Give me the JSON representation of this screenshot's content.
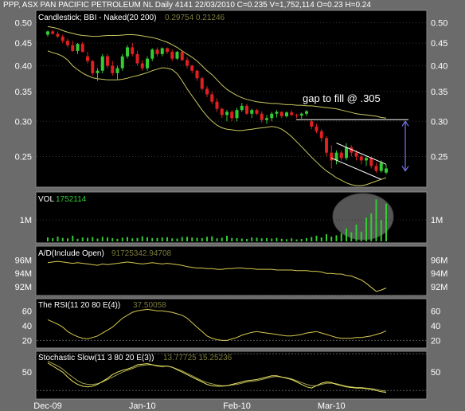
{
  "header": {
    "text": "PPP, ASX PAN PACIFIC PETROLEUM NL Daily 4141 22/03/2010 C=0.235 V=1,752,114 O=0.23 H=0.24"
  },
  "colors": {
    "background": "#6b6b6b",
    "panel": "#000000",
    "up": "#33cc33",
    "down": "#e02020",
    "band": "#c8c860",
    "line": "#d8c850",
    "volume": "#33cc33",
    "annotation": "#ffffff",
    "arrow": "#7777ee",
    "ellipse": "#555555"
  },
  "panels": {
    "price": {
      "label": "Candlestick; BBI - Naked(20  200)",
      "readout": "0.29754  0.21246",
      "yticks": [
        {
          "label": "0.50",
          "value": 0.5
        },
        {
          "label": "0.45",
          "value": 0.45
        },
        {
          "label": "0.40",
          "value": 0.4
        },
        {
          "label": "0.35",
          "value": 0.35
        },
        {
          "label": "0.30",
          "value": 0.3
        },
        {
          "label": "0.25",
          "value": 0.25
        }
      ],
      "annotation": "gap to fill @ .305"
    },
    "volume": {
      "label": "VOL",
      "readout": "1752114",
      "yticks": [
        {
          "label": "1M",
          "value": 1000000
        }
      ]
    },
    "ad": {
      "label": "A/D(Include Open)",
      "readout": "91725342.94708",
      "yticks": [
        {
          "label": "96M",
          "value": 96
        },
        {
          "label": "94M",
          "value": 94
        },
        {
          "label": "92M",
          "value": 92
        }
      ]
    },
    "rsi": {
      "label": "The RSI(11  20  80 E(4))",
      "readout": "37.50058",
      "yticks": [
        {
          "label": "60",
          "value": 60
        },
        {
          "label": "40",
          "value": 40
        },
        {
          "label": "20",
          "value": 20
        }
      ]
    },
    "stoch": {
      "label": "Stochastic Slow(11  3  80  20 E(3))",
      "readout": "13.77725  15.25236",
      "yticks": [
        {
          "label": "50",
          "value": 50
        }
      ]
    }
  },
  "xaxis": {
    "labels": [
      {
        "label": "Dec-09",
        "index": 0
      },
      {
        "label": "Jan-10",
        "index": 19
      },
      {
        "label": "Feb-10",
        "index": 38
      },
      {
        "label": "Mar-10",
        "index": 57
      }
    ]
  },
  "chart_data": {
    "type": "candlestick",
    "instrument": "PPP, ASX PAN PACIFIC PETROLEUM NL",
    "period": "Daily",
    "candles": [
      {
        "o": 0.47,
        "h": 0.48,
        "l": 0.465,
        "c": 0.478
      },
      {
        "o": 0.478,
        "h": 0.482,
        "l": 0.47,
        "c": 0.472
      },
      {
        "o": 0.472,
        "h": 0.478,
        "l": 0.462,
        "c": 0.465
      },
      {
        "o": 0.465,
        "h": 0.47,
        "l": 0.45,
        "c": 0.455
      },
      {
        "o": 0.455,
        "h": 0.46,
        "l": 0.44,
        "c": 0.445
      },
      {
        "o": 0.445,
        "h": 0.455,
        "l": 0.43,
        "c": 0.432
      },
      {
        "o": 0.432,
        "h": 0.45,
        "l": 0.425,
        "c": 0.448
      },
      {
        "o": 0.448,
        "h": 0.452,
        "l": 0.428,
        "c": 0.43
      },
      {
        "o": 0.42,
        "h": 0.43,
        "l": 0.405,
        "c": 0.41
      },
      {
        "o": 0.41,
        "h": 0.412,
        "l": 0.38,
        "c": 0.385
      },
      {
        "o": 0.385,
        "h": 0.395,
        "l": 0.37,
        "c": 0.39
      },
      {
        "o": 0.39,
        "h": 0.425,
        "l": 0.385,
        "c": 0.42
      },
      {
        "o": 0.42,
        "h": 0.425,
        "l": 0.395,
        "c": 0.4
      },
      {
        "o": 0.4,
        "h": 0.41,
        "l": 0.38,
        "c": 0.385
      },
      {
        "o": 0.385,
        "h": 0.4,
        "l": 0.372,
        "c": 0.395
      },
      {
        "o": 0.395,
        "h": 0.425,
        "l": 0.39,
        "c": 0.42
      },
      {
        "o": 0.42,
        "h": 0.445,
        "l": 0.415,
        "c": 0.44
      },
      {
        "o": 0.44,
        "h": 0.45,
        "l": 0.42,
        "c": 0.425
      },
      {
        "o": 0.425,
        "h": 0.432,
        "l": 0.4,
        "c": 0.405
      },
      {
        "o": 0.405,
        "h": 0.412,
        "l": 0.39,
        "c": 0.395
      },
      {
        "o": 0.395,
        "h": 0.42,
        "l": 0.39,
        "c": 0.415
      },
      {
        "o": 0.415,
        "h": 0.438,
        "l": 0.41,
        "c": 0.435
      },
      {
        "o": 0.435,
        "h": 0.44,
        "l": 0.42,
        "c": 0.425
      },
      {
        "o": 0.425,
        "h": 0.44,
        "l": 0.42,
        "c": 0.438
      },
      {
        "o": 0.438,
        "h": 0.44,
        "l": 0.425,
        "c": 0.43
      },
      {
        "o": 0.43,
        "h": 0.435,
        "l": 0.41,
        "c": 0.415
      },
      {
        "o": 0.415,
        "h": 0.432,
        "l": 0.412,
        "c": 0.43
      },
      {
        "o": 0.43,
        "h": 0.432,
        "l": 0.41,
        "c": 0.412
      },
      {
        "o": 0.412,
        "h": 0.418,
        "l": 0.395,
        "c": 0.4
      },
      {
        "o": 0.4,
        "h": 0.402,
        "l": 0.385,
        "c": 0.39
      },
      {
        "o": 0.39,
        "h": 0.392,
        "l": 0.37,
        "c": 0.375
      },
      {
        "o": 0.375,
        "h": 0.378,
        "l": 0.352,
        "c": 0.355
      },
      {
        "o": 0.355,
        "h": 0.36,
        "l": 0.34,
        "c": 0.345
      },
      {
        "o": 0.345,
        "h": 0.35,
        "l": 0.328,
        "c": 0.332
      },
      {
        "o": 0.332,
        "h": 0.338,
        "l": 0.315,
        "c": 0.32
      },
      {
        "o": 0.32,
        "h": 0.322,
        "l": 0.305,
        "c": 0.31
      },
      {
        "o": 0.31,
        "h": 0.318,
        "l": 0.3,
        "c": 0.315
      },
      {
        "o": 0.315,
        "h": 0.318,
        "l": 0.3,
        "c": 0.305
      },
      {
        "o": 0.305,
        "h": 0.322,
        "l": 0.3,
        "c": 0.318
      },
      {
        "o": 0.318,
        "h": 0.33,
        "l": 0.315,
        "c": 0.325
      },
      {
        "o": 0.325,
        "h": 0.328,
        "l": 0.31,
        "c": 0.312
      },
      {
        "o": 0.312,
        "h": 0.32,
        "l": 0.305,
        "c": 0.318
      },
      {
        "o": 0.318,
        "h": 0.32,
        "l": 0.31,
        "c": 0.312
      },
      {
        "o": 0.312,
        "h": 0.316,
        "l": 0.298,
        "c": 0.302
      },
      {
        "o": 0.302,
        "h": 0.31,
        "l": 0.296,
        "c": 0.305
      },
      {
        "o": 0.305,
        "h": 0.315,
        "l": 0.3,
        "c": 0.312
      },
      {
        "o": 0.312,
        "h": 0.318,
        "l": 0.306,
        "c": 0.315
      },
      {
        "o": 0.315,
        "h": 0.316,
        "l": 0.305,
        "c": 0.308
      },
      {
        "o": 0.308,
        "h": 0.316,
        "l": 0.306,
        "c": 0.314
      },
      {
        "o": 0.314,
        "h": 0.318,
        "l": 0.308,
        "c": 0.31
      },
      {
        "o": 0.31,
        "h": 0.312,
        "l": 0.305,
        "c": 0.309
      },
      {
        "o": 0.309,
        "h": 0.314,
        "l": 0.304,
        "c": 0.312
      },
      {
        "o": 0.312,
        "h": 0.318,
        "l": 0.308,
        "c": 0.316
      },
      {
        "o": 0.3,
        "h": 0.302,
        "l": 0.288,
        "c": 0.292
      },
      {
        "o": 0.292,
        "h": 0.296,
        "l": 0.282,
        "c": 0.285
      },
      {
        "o": 0.285,
        "h": 0.288,
        "l": 0.27,
        "c": 0.275
      },
      {
        "o": 0.275,
        "h": 0.278,
        "l": 0.25,
        "c": 0.255
      },
      {
        "o": 0.255,
        "h": 0.265,
        "l": 0.235,
        "c": 0.245
      },
      {
        "o": 0.245,
        "h": 0.258,
        "l": 0.24,
        "c": 0.255
      },
      {
        "o": 0.255,
        "h": 0.258,
        "l": 0.245,
        "c": 0.248
      },
      {
        "o": 0.248,
        "h": 0.268,
        "l": 0.245,
        "c": 0.262
      },
      {
        "o": 0.262,
        "h": 0.265,
        "l": 0.25,
        "c": 0.255
      },
      {
        "o": 0.255,
        "h": 0.258,
        "l": 0.245,
        "c": 0.25
      },
      {
        "o": 0.25,
        "h": 0.252,
        "l": 0.24,
        "c": 0.245
      },
      {
        "o": 0.245,
        "h": 0.25,
        "l": 0.238,
        "c": 0.248
      },
      {
        "o": 0.248,
        "h": 0.25,
        "l": 0.235,
        "c": 0.238
      },
      {
        "o": 0.238,
        "h": 0.242,
        "l": 0.23,
        "c": 0.232
      },
      {
        "o": 0.232,
        "h": 0.245,
        "l": 0.23,
        "c": 0.242
      },
      {
        "o": 0.23,
        "h": 0.24,
        "l": 0.228,
        "c": 0.235
      }
    ],
    "volume": [
      180000,
      150000,
      220000,
      160000,
      140000,
      260000,
      120000,
      180000,
      160000,
      200000,
      130000,
      210000,
      180000,
      150000,
      120000,
      170000,
      200000,
      140000,
      160000,
      230000,
      190000,
      150000,
      160000,
      180000,
      190000,
      140000,
      130000,
      200000,
      210000,
      180000,
      160000,
      150000,
      210000,
      230000,
      140000,
      170000,
      260000,
      160000,
      150000,
      130000,
      110000,
      180000,
      170000,
      140000,
      150000,
      130000,
      160000,
      120000,
      100000,
      140000,
      90000,
      110000,
      150000,
      200000,
      260000,
      180000,
      330000,
      220000,
      280000,
      380000,
      600000,
      420000,
      780000,
      450000,
      1100000,
      1300000,
      1950000,
      1000000,
      1752114
    ],
    "upper_band": [
      0.49,
      0.488,
      0.485,
      0.48,
      0.476,
      0.473,
      0.47,
      0.468,
      0.467,
      0.466,
      0.466,
      0.467,
      0.468,
      0.468,
      0.468,
      0.469,
      0.47,
      0.47,
      0.469,
      0.467,
      0.465,
      0.463,
      0.46,
      0.456,
      0.452,
      0.446,
      0.44,
      0.432,
      0.425,
      0.418,
      0.41,
      0.4,
      0.39,
      0.382,
      0.372,
      0.362,
      0.354,
      0.348,
      0.343,
      0.339,
      0.336,
      0.334,
      0.332,
      0.331,
      0.33,
      0.329,
      0.329,
      0.328,
      0.327,
      0.327,
      0.326,
      0.326,
      0.325,
      0.325,
      0.324,
      0.323,
      0.322,
      0.321,
      0.32,
      0.318,
      0.316,
      0.314,
      0.312,
      0.311,
      0.31,
      0.309,
      0.308,
      0.306,
      0.305
    ],
    "lower_band": [
      0.432,
      0.428,
      0.425,
      0.42,
      0.412,
      0.4,
      0.392,
      0.385,
      0.38,
      0.376,
      0.374,
      0.373,
      0.372,
      0.372,
      0.372,
      0.373,
      0.375,
      0.378,
      0.38,
      0.383,
      0.386,
      0.39,
      0.393,
      0.396,
      0.395,
      0.392,
      0.384,
      0.37,
      0.355,
      0.342,
      0.33,
      0.318,
      0.308,
      0.3,
      0.294,
      0.29,
      0.288,
      0.287,
      0.286,
      0.286,
      0.287,
      0.288,
      0.289,
      0.29,
      0.291,
      0.292,
      0.291,
      0.288,
      0.283,
      0.277,
      0.27,
      0.263,
      0.256,
      0.249,
      0.243,
      0.237,
      0.232,
      0.228,
      0.224,
      0.221,
      0.218,
      0.216,
      0.215,
      0.215,
      0.216,
      0.218,
      0.22,
      0.222,
      0.224
    ],
    "ad_line": [
      95.6,
      95.7,
      95.8,
      95.7,
      95.6,
      95.5,
      95.6,
      95.5,
      95.4,
      95.3,
      95.2,
      95.4,
      95.3,
      95.4,
      95.5,
      95.6,
      95.7,
      95.6,
      95.5,
      95.4,
      95.5,
      95.6,
      95.5,
      95.4,
      95.5,
      95.4,
      95.3,
      95.2,
      95.0,
      94.9,
      94.8,
      94.8,
      94.7,
      94.7,
      94.6,
      94.6,
      94.7,
      94.7,
      94.8,
      94.8,
      94.7,
      94.7,
      94.6,
      94.6,
      94.6,
      94.6,
      94.5,
      94.5,
      94.5,
      94.5,
      94.4,
      94.4,
      94.4,
      94.3,
      94.3,
      94.2,
      94.0,
      94.0,
      93.9,
      93.9,
      93.7,
      93.6,
      93.3,
      93.0,
      92.5,
      91.9,
      91.3,
      91.5,
      91.8
    ],
    "rsi": [
      48,
      45,
      42,
      38,
      32,
      28,
      25,
      23,
      22,
      24,
      26,
      30,
      34,
      38,
      44,
      50,
      54,
      58,
      60,
      61,
      62,
      61,
      60,
      60,
      59,
      58,
      56,
      54,
      50,
      44,
      38,
      32,
      26,
      23,
      21,
      20,
      20,
      22,
      24,
      27,
      29,
      31,
      32,
      31,
      30,
      29,
      28,
      27,
      26,
      26,
      27,
      28,
      30,
      31,
      32,
      30,
      28,
      26,
      24,
      23,
      23,
      23,
      24,
      24,
      25,
      26,
      28,
      30,
      33
    ],
    "stoch_k": [
      65,
      60,
      55,
      50,
      42,
      35,
      30,
      27,
      26,
      27,
      30,
      35,
      40,
      46,
      50,
      53,
      55,
      58,
      62,
      63,
      64,
      62,
      60,
      59,
      60,
      58,
      54,
      50,
      46,
      42,
      38,
      34,
      30,
      28,
      27,
      27,
      28,
      30,
      32,
      34,
      36,
      37,
      38,
      40,
      42,
      44,
      44,
      42,
      40,
      38,
      34,
      30,
      26,
      24,
      28,
      32,
      34,
      33,
      30,
      28,
      26,
      25,
      24,
      24,
      23,
      22,
      20,
      18,
      17
    ],
    "stoch_d": [
      68,
      64,
      60,
      55,
      48,
      42,
      36,
      32,
      30,
      30,
      31,
      34,
      38,
      42,
      46,
      50,
      53,
      56,
      59,
      61,
      62,
      62,
      61,
      60,
      60,
      58,
      55,
      52,
      48,
      44,
      40,
      36,
      33,
      31,
      29,
      28,
      28,
      29,
      30,
      32,
      34,
      35,
      36,
      38,
      40,
      42,
      43,
      42,
      41,
      39,
      36,
      33,
      30,
      28,
      28,
      30,
      32,
      32,
      31,
      29,
      27,
      26,
      25,
      25,
      24,
      23,
      22,
      20,
      19
    ]
  }
}
